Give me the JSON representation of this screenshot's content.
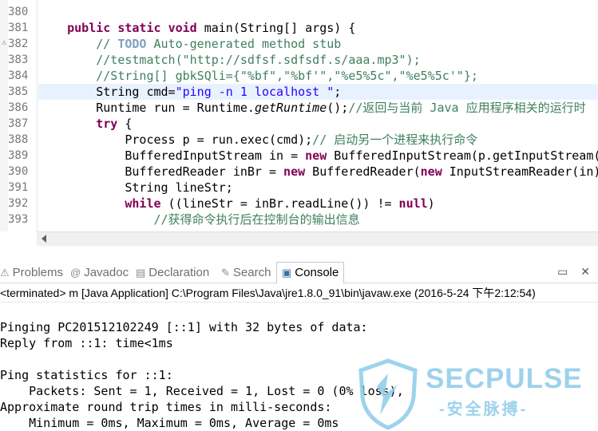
{
  "editor": {
    "lines": [
      {
        "num": "380",
        "segments": []
      },
      {
        "num": "381",
        "segments": [
          {
            "t": "    "
          },
          {
            "t": "public",
            "c": "kw"
          },
          {
            "t": " "
          },
          {
            "t": "static",
            "c": "kw"
          },
          {
            "t": " "
          },
          {
            "t": "void",
            "c": "kw"
          },
          {
            "t": " main(String[] args) {"
          }
        ]
      },
      {
        "num": "382",
        "segments": [
          {
            "t": "        "
          },
          {
            "t": "// ",
            "c": "cm"
          },
          {
            "t": "TODO",
            "c": "tg"
          },
          {
            "t": " Auto-generated method stub",
            "c": "cm"
          }
        ]
      },
      {
        "num": "383",
        "segments": [
          {
            "t": "        "
          },
          {
            "t": "//testmatch(\"http://sdfsf.sdfsdf.s/aaa.mp3\");",
            "c": "cm"
          }
        ]
      },
      {
        "num": "384",
        "segments": [
          {
            "t": "        "
          },
          {
            "t": "//String[] gbkSQli={\"%bf\",\"%bf'\",\"%e5%5c\",\"%e5%5c'\"};",
            "c": "cm"
          }
        ]
      },
      {
        "num": "385",
        "segments": [
          {
            "t": "        String cmd="
          },
          {
            "t": "\"ping -n 1 localhost \"",
            "c": "st"
          },
          {
            "t": ";"
          }
        ]
      },
      {
        "num": "386",
        "segments": [
          {
            "t": "        Runtime run = Runtime."
          },
          {
            "t": "getRuntime",
            "c": "it"
          },
          {
            "t": "();"
          },
          {
            "t": "//返回与当前 Java 应用程序相关的运行时",
            "c": "cm"
          }
        ]
      },
      {
        "num": "387",
        "segments": [
          {
            "t": "        "
          },
          {
            "t": "try",
            "c": "kw"
          },
          {
            "t": " {"
          }
        ]
      },
      {
        "num": "388",
        "segments": [
          {
            "t": "            Process p = run.exec(cmd);"
          },
          {
            "t": "// 启动另一个进程来执行命令",
            "c": "cm"
          }
        ]
      },
      {
        "num": "389",
        "segments": [
          {
            "t": "            BufferedInputStream in = "
          },
          {
            "t": "new",
            "c": "kw"
          },
          {
            "t": " BufferedInputStream(p.getInputStream("
          }
        ]
      },
      {
        "num": "390",
        "segments": [
          {
            "t": "            BufferedReader inBr = "
          },
          {
            "t": "new",
            "c": "kw"
          },
          {
            "t": " BufferedReader("
          },
          {
            "t": "new",
            "c": "kw"
          },
          {
            "t": " InputStreamReader(in)"
          }
        ]
      },
      {
        "num": "391",
        "segments": [
          {
            "t": "            String lineStr;"
          }
        ]
      },
      {
        "num": "392",
        "segments": [
          {
            "t": "            "
          },
          {
            "t": "while",
            "c": "kw"
          },
          {
            "t": " ((lineStr = inBr.readLine()) != "
          },
          {
            "t": "null",
            "c": "kw"
          },
          {
            "t": ")"
          }
        ]
      },
      {
        "num": "393",
        "segments": [
          {
            "t": "                "
          },
          {
            "t": "//获得命令执行后在控制台的输出信息",
            "c": "cm"
          }
        ]
      }
    ]
  },
  "tabs": [
    {
      "label": "Problems",
      "icon": "problems-icon",
      "glyph": "⚠"
    },
    {
      "label": "Javadoc",
      "icon": "javadoc-icon",
      "glyph": "@"
    },
    {
      "label": "Declaration",
      "icon": "declaration-icon",
      "glyph": "▤"
    },
    {
      "label": "Search",
      "icon": "search-icon",
      "glyph": "✎"
    },
    {
      "label": "Console",
      "icon": "console-icon",
      "glyph": "▣"
    }
  ],
  "tab_controls": {
    "minimize": "▭",
    "close": "✕"
  },
  "console": {
    "status": "<terminated> m [Java Application] C:\\Program Files\\Java\\jre1.8.0_91\\bin\\javaw.exe (2016-5-24 下午2:12:54)",
    "output": [
      "",
      "Pinging PC201512102249 [::1] with 32 bytes of data:",
      "Reply from ::1: time<1ms",
      "",
      "Ping statistics for ::1:",
      "    Packets: Sent = 1, Received = 1, Lost = 0 (0% loss),",
      "Approximate round trip times in milli-seconds:",
      "    Minimum = 0ms, Maximum = 0ms, Average = 0ms"
    ]
  },
  "watermark": {
    "title": "SECPULSE",
    "subtitle": "-安全脉搏-"
  },
  "colors": {
    "keyword": "#7f0055",
    "comment": "#3f7f5f",
    "string": "#2a00ff",
    "todo": "#7f9fbf",
    "highlight": "#e8f2fe",
    "watermark": "#8ccbe9"
  }
}
